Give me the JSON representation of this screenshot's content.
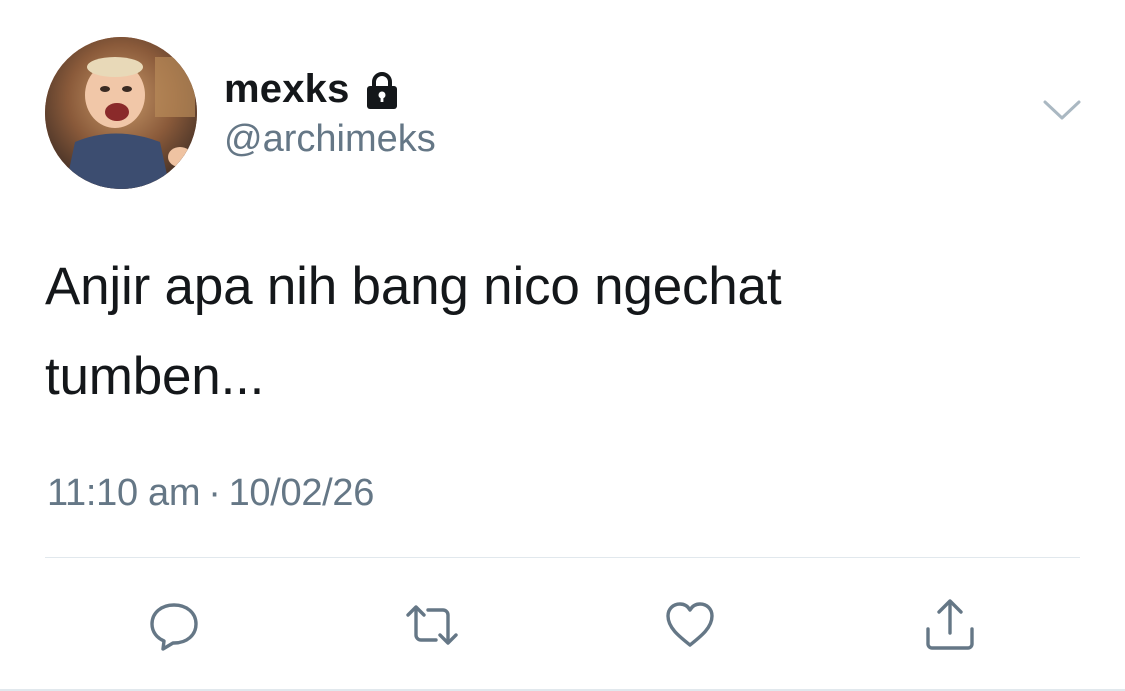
{
  "user": {
    "display_name": "mexks",
    "handle": "@archimeks",
    "protected": true,
    "avatar_icon": "user-avatar"
  },
  "tweet": {
    "text_line1": "Anjir apa nih bang nico ngechat",
    "text_line2": "tumben...",
    "time": "11:10 am",
    "separator": "·",
    "date": "10/02/26"
  },
  "icons": {
    "lock": "lock-icon",
    "more": "chevron-down-icon",
    "reply": "reply-icon",
    "retweet": "retweet-icon",
    "like": "heart-icon",
    "share": "share-icon"
  },
  "colors": {
    "text": "#14171a",
    "secondary": "#657786",
    "divider": "#e1e8ed",
    "background": "#ffffff"
  }
}
